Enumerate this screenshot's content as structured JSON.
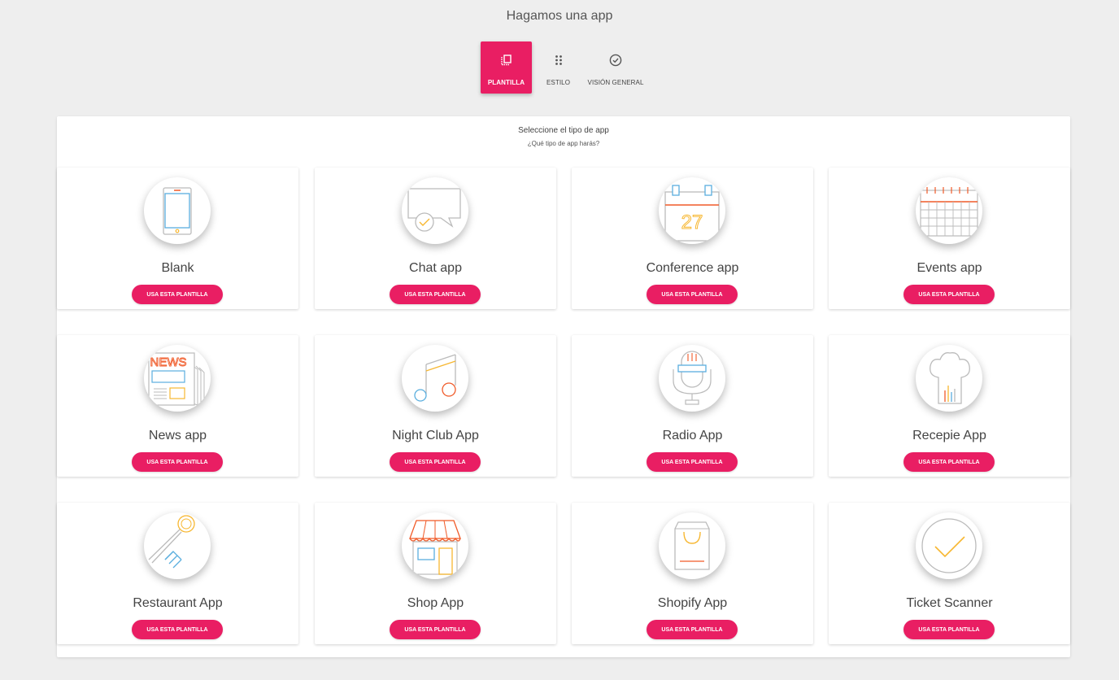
{
  "page": {
    "title": "Hagamos una app"
  },
  "steps": [
    {
      "label": "PLANTILLA",
      "icon": "template-icon",
      "active": true
    },
    {
      "label": "ESTILO",
      "icon": "dots-grid-icon",
      "active": false
    },
    {
      "label": "VISIÓN GENERAL",
      "icon": "check-circle-icon",
      "active": false
    }
  ],
  "panel": {
    "heading": "Seleccione el tipo de app",
    "subheading": "¿Qué tipo de app harás?",
    "button_label": "USA ESTA PLANTILLA"
  },
  "templates": [
    {
      "name": "Blank",
      "icon": "tablet-icon"
    },
    {
      "name": "Chat app",
      "icon": "chat-bubble-icon"
    },
    {
      "name": "Conference app",
      "icon": "calendar-27-icon"
    },
    {
      "name": "Events app",
      "icon": "calendar-grid-icon"
    },
    {
      "name": "News app",
      "icon": "newspaper-icon"
    },
    {
      "name": "Night Club App",
      "icon": "music-note-icon"
    },
    {
      "name": "Radio App",
      "icon": "microphone-icon"
    },
    {
      "name": "Recepie App",
      "icon": "chef-hat-icon"
    },
    {
      "name": "Restaurant App",
      "icon": "spoon-fork-icon"
    },
    {
      "name": "Shop App",
      "icon": "storefront-icon"
    },
    {
      "name": "Shopify App",
      "icon": "shopping-bag-icon"
    },
    {
      "name": "Ticket Scanner",
      "icon": "checkmark-icon"
    }
  ],
  "colors": {
    "accent": "#e91e63",
    "background": "#eeeeee",
    "icon_orange": "#f05a28",
    "icon_yellow": "#f7b731",
    "icon_blue": "#5aaede",
    "icon_gray": "#bbbbbb"
  }
}
